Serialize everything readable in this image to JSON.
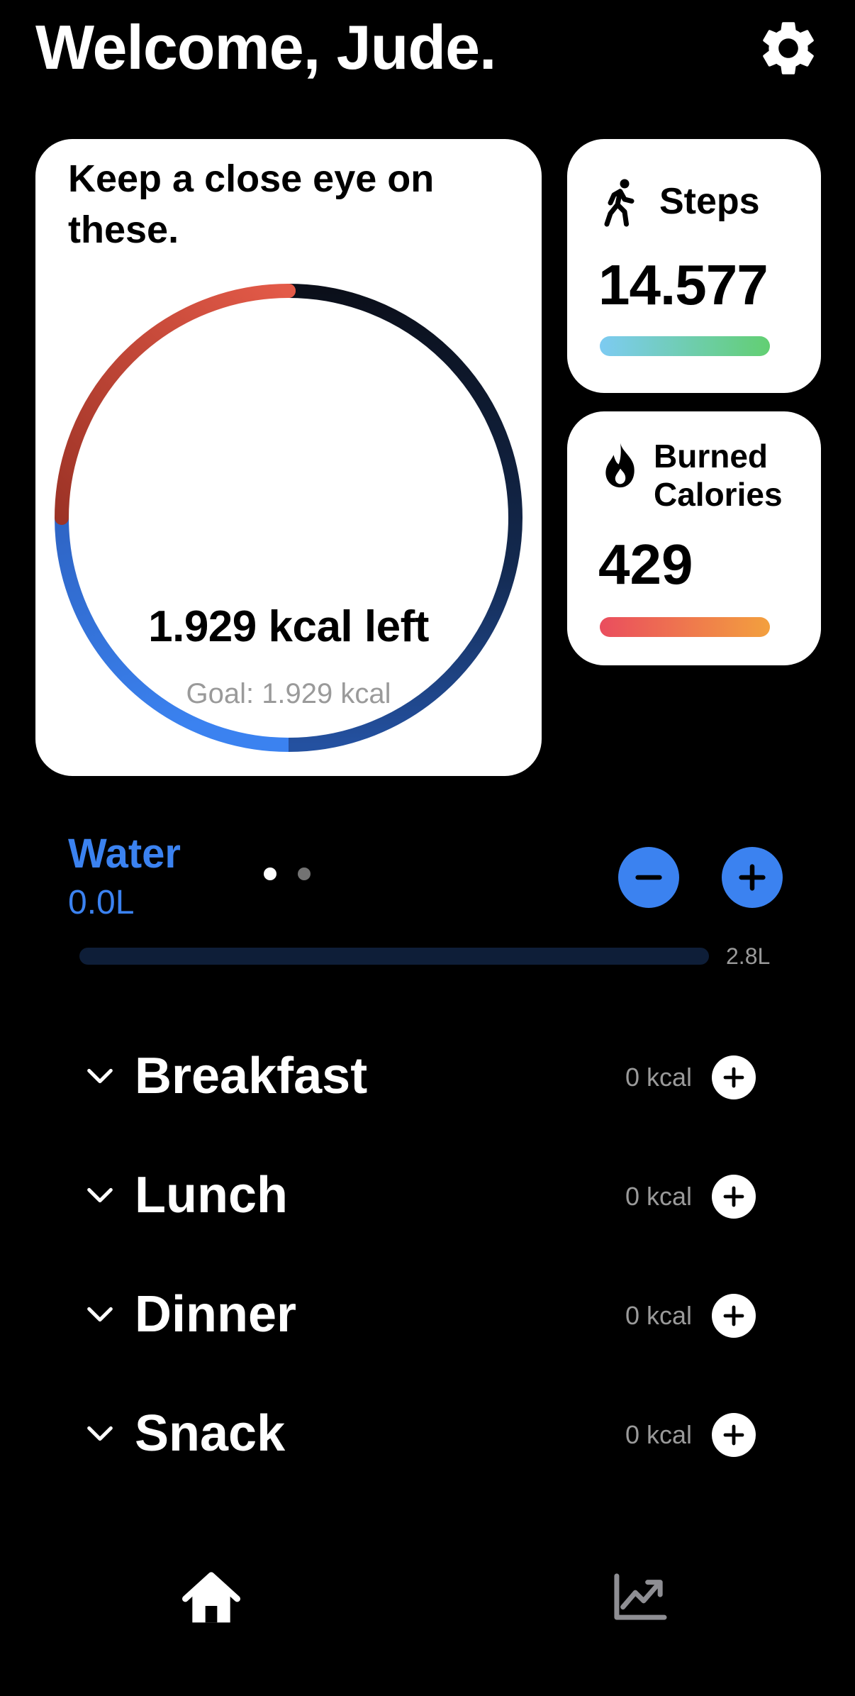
{
  "header": {
    "title": "Welcome, Jude.",
    "settings_icon": "gear-icon"
  },
  "summary_card": {
    "title": "Keep a close eye on these.",
    "kcal_left": "1.929 kcal left",
    "goal": "Goal: 1.929 kcal",
    "page_count": 2,
    "current_page": 1,
    "ring_colors": [
      "#e35a48",
      "#9d3326",
      "#2e64c4",
      "#3b82f0",
      "#0f1e3c"
    ]
  },
  "steps_card": {
    "icon": "walking-icon",
    "title": "Steps",
    "value": "14.577",
    "bar_colors": [
      "#7dcbf2",
      "#62cf72"
    ]
  },
  "calories_card": {
    "icon": "flame-icon",
    "title_line1": "Burned",
    "title_line2": "Calories",
    "value": "429",
    "bar_colors": [
      "#ea4d5e",
      "#f3a03e"
    ]
  },
  "water": {
    "title": "Water",
    "amount": "0.0L",
    "max": "2.8L",
    "progress": 0,
    "minus_icon": "minus-icon",
    "plus_icon": "plus-icon",
    "accent": "#3b82f0"
  },
  "meals": [
    {
      "name": "Breakfast",
      "kcal": "0 kcal"
    },
    {
      "name": "Lunch",
      "kcal": "0 kcal"
    },
    {
      "name": "Dinner",
      "kcal": "0 kcal"
    },
    {
      "name": "Snack",
      "kcal": "0 kcal"
    }
  ],
  "tab_bar": {
    "home_icon": "home-icon",
    "stats_icon": "chart-icon"
  }
}
